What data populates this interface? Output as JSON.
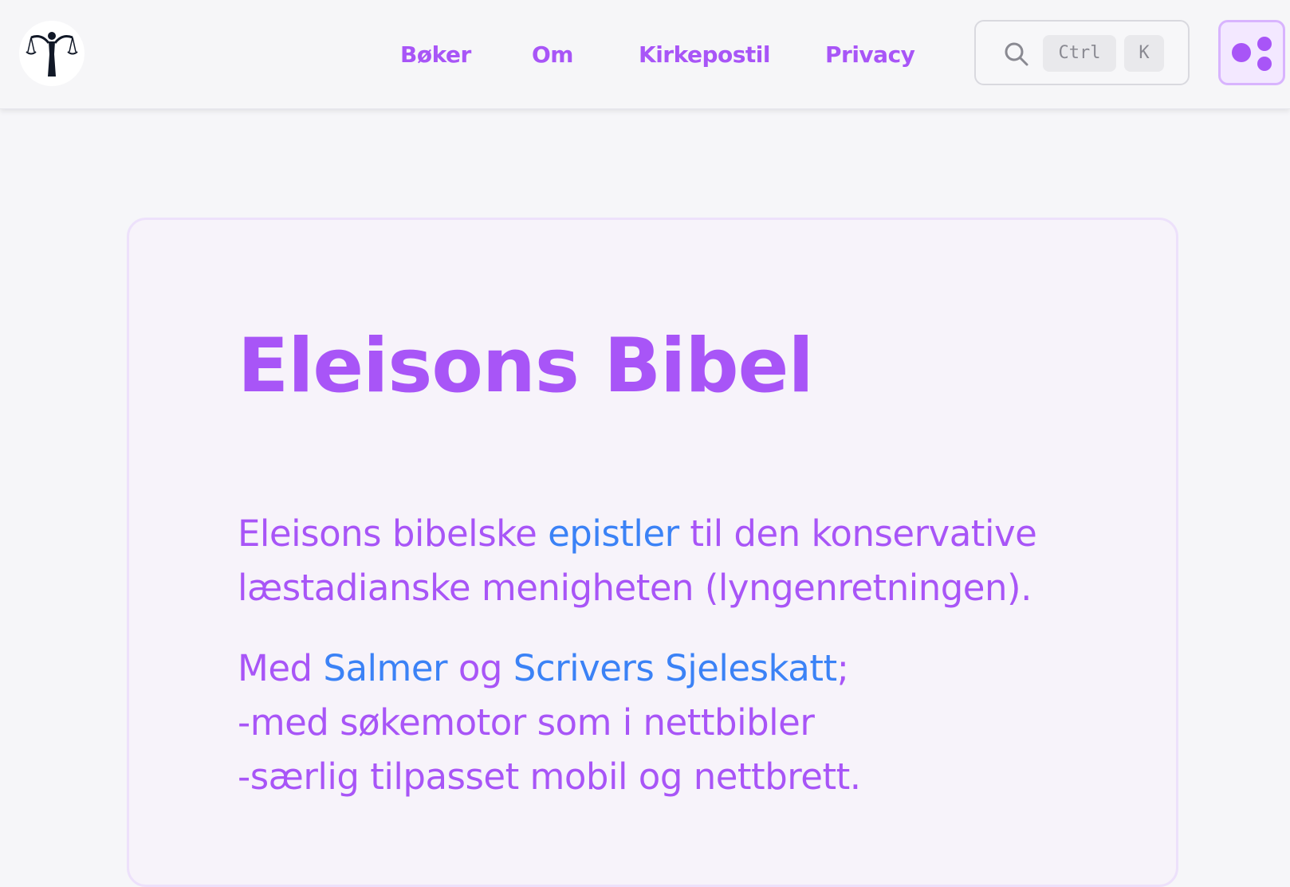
{
  "nav": {
    "links": [
      "Bøker",
      "Om",
      "Kirkepostil",
      "Privacy"
    ],
    "search": {
      "kbd_ctrl": "Ctrl",
      "kbd_k": "K"
    }
  },
  "hero": {
    "title": "Eleisons Bibel",
    "para1": {
      "before": "Eleisons bibelske ",
      "link": "epistler",
      "after_line1": " til den konservative",
      "line2": "læstadianske menigheten (lyngenretningen)."
    },
    "para2": {
      "prefix": "Med ",
      "link1": "Salmer",
      "middle": " og ",
      "link2": "Scrivers Sjeleskatt",
      "suffix": ";",
      "line2": "-med søkemotor som i nettbibler",
      "line3": "-særlig tilpasset mobil og nettbrett."
    }
  },
  "colors": {
    "accent": "#a855f7",
    "link": "#3b82f6"
  },
  "icons": {
    "logo": "scales-of-justice-logo",
    "search": "search-icon",
    "theme": "theme-toggle-icon"
  }
}
